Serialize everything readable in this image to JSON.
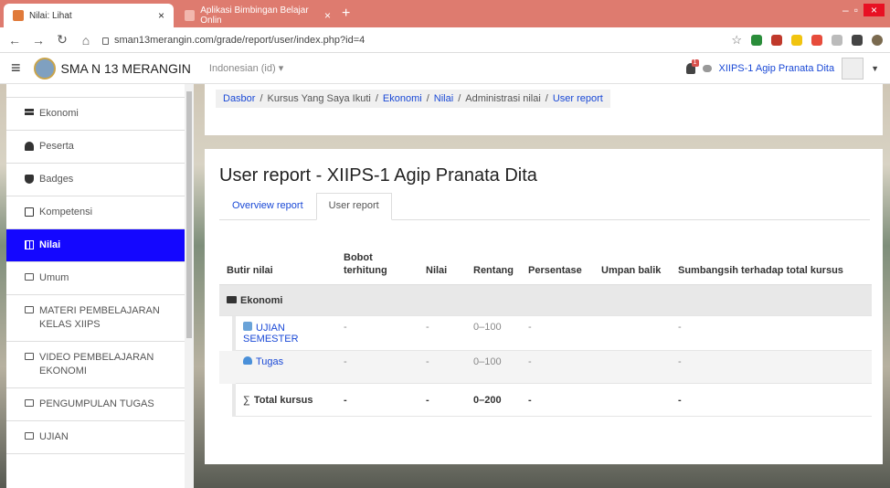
{
  "browser": {
    "tabs": [
      {
        "title": "Nilai: Lihat",
        "active": true
      },
      {
        "title": "Aplikasi Bimbingan Belajar Onlin",
        "active": false
      }
    ],
    "new_tab": "+",
    "url": "sman13merangin.com/grade/report/user/index.php?id=4",
    "win_min": "–",
    "win_max": "▫",
    "win_close": "×"
  },
  "navbar": {
    "site_name": "SMA N 13 MERANGIN",
    "language": "Indonesian (id) ▾",
    "notification_count": "1",
    "user_name": "XIIPS-1 Agip Pranata Dita"
  },
  "sidebar": {
    "items": [
      {
        "label": "Ekonomi",
        "icon": "graduation-cap-icon"
      },
      {
        "label": "Peserta",
        "icon": "users-icon"
      },
      {
        "label": "Badges",
        "icon": "shield-icon"
      },
      {
        "label": "Kompetensi",
        "icon": "check-square-icon"
      },
      {
        "label": "Nilai",
        "icon": "table-icon",
        "active": true
      },
      {
        "label": "Umum",
        "icon": "folder-icon"
      },
      {
        "label": "MATERI PEMBELAJARAN KELAS XIIPS",
        "icon": "folder-icon"
      },
      {
        "label": "VIDEO PEMBELAJARAN EKONOMI",
        "icon": "folder-icon"
      },
      {
        "label": "PENGUMPULAN TUGAS",
        "icon": "folder-icon"
      },
      {
        "label": "UJIAN",
        "icon": "folder-icon"
      }
    ]
  },
  "breadcrumb": {
    "items": [
      "Dasbor",
      "Kursus Yang Saya Ikuti",
      "Ekonomi",
      "Nilai",
      "Administrasi nilai",
      "User report"
    ],
    "separator": "/"
  },
  "main": {
    "title": "User report - XIIPS-1 Agip Pranata Dita",
    "tabs": [
      "Overview report",
      "User report"
    ],
    "columns": [
      "Butir nilai",
      "Bobot terhitung",
      "Nilai",
      "Rentang",
      "Persentase",
      "Umpan balik",
      "Sumbangsih terhadap total kursus"
    ],
    "category": "Ekonomi",
    "rows": [
      {
        "name": "UJIAN SEMESTER",
        "icon": "quiz-icon",
        "bobot": "-",
        "nilai": "-",
        "rentang": "0–100",
        "persentase": "-",
        "umpan": "",
        "sumbangsih": "-"
      },
      {
        "name": "Tugas",
        "icon": "assignment-icon",
        "bobot": "-",
        "nilai": "-",
        "rentang": "0–100",
        "persentase": "-",
        "umpan": "",
        "sumbangsih": "-"
      }
    ],
    "total": {
      "name": "Total kursus",
      "bobot": "-",
      "nilai": "-",
      "rentang": "0–200",
      "persentase": "-",
      "umpan": "",
      "sumbangsih": "-"
    }
  },
  "colors": {
    "accent": "#1407ff",
    "link": "#1a49d6",
    "chrome_tab": "#de7b6f"
  }
}
